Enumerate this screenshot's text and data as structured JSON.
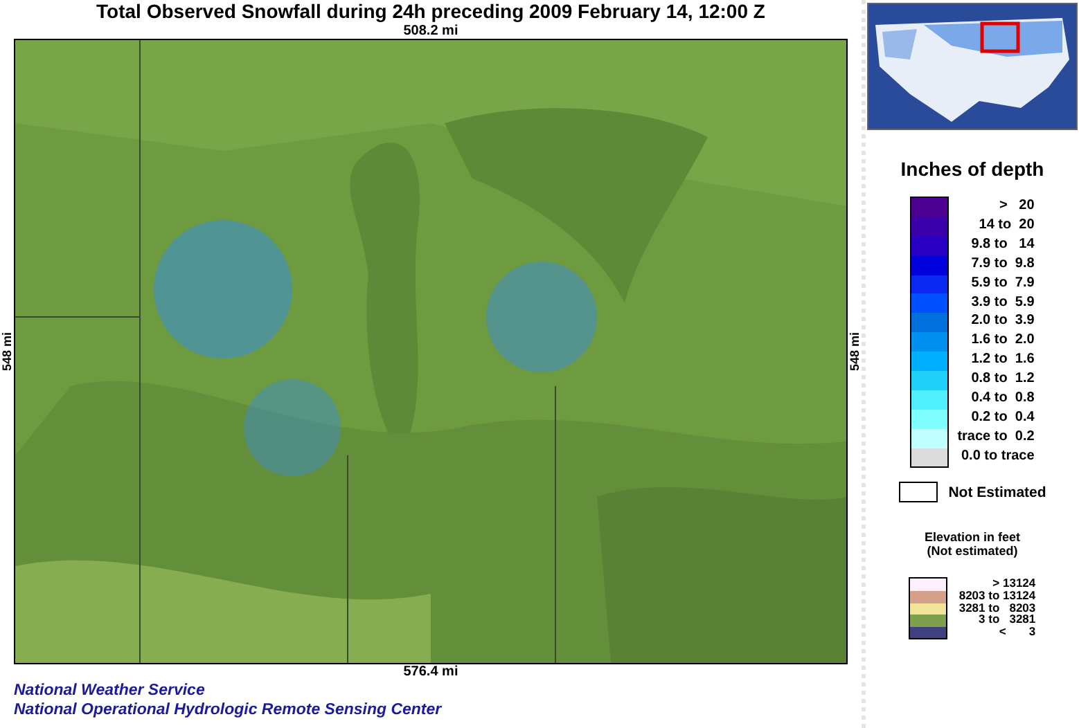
{
  "title": "Total Observed Snowfall during 24h preceding 2009 February 14, 12:00 Z",
  "map": {
    "kind": "picture",
    "top_scale": "508.2 mi",
    "bottom_scale": "576.4 mi",
    "left_scale": "548 mi",
    "right_scale": "548 mi"
  },
  "legend": {
    "title": "Inches of depth",
    "items": [
      {
        "label": ">   20",
        "color": "#4b0090"
      },
      {
        "label": "14 to  20",
        "color": "#3c00aa"
      },
      {
        "label": "9.8 to   14",
        "color": "#2a00c4"
      },
      {
        "label": "7.9 to  9.8",
        "color": "#0000dc"
      },
      {
        "label": "5.9 to  7.9",
        "color": "#0a28f0"
      },
      {
        "label": "3.9 to  5.9",
        "color": "#0050ff"
      },
      {
        "label": "2.0 to  3.9",
        "color": "#0070dc"
      },
      {
        "label": "1.6 to  2.0",
        "color": "#0090f0"
      },
      {
        "label": "1.2 to  1.6",
        "color": "#00b0ff"
      },
      {
        "label": "0.8 to  1.2",
        "color": "#20d0f8"
      },
      {
        "label": "0.4 to  0.8",
        "color": "#50f0ff"
      },
      {
        "label": "0.2 to  0.4",
        "color": "#80ffff"
      },
      {
        "label": "trace to  0.2",
        "color": "#c0ffff"
      },
      {
        "label": "0.0 to trace",
        "color": "#dcdcdc"
      }
    ],
    "not_estimated": {
      "label": "Not Estimated",
      "color": "#ffffff"
    }
  },
  "elevation": {
    "title": "Elevation in feet",
    "subtitle": "(Not estimated)",
    "items": [
      {
        "label": "> 13124",
        "color": "#fff0ff"
      },
      {
        "label": "8203 to 13124",
        "color": "#d4a08a"
      },
      {
        "label": "3281 to   8203",
        "color": "#f0e496"
      },
      {
        "label": "3 to   3281",
        "color": "#7ea04e"
      },
      {
        "label": "<       3",
        "color": "#404080"
      }
    ]
  },
  "footer": [
    "National Weather Service",
    "National Operational Hydrologic Remote Sensing Center"
  ]
}
